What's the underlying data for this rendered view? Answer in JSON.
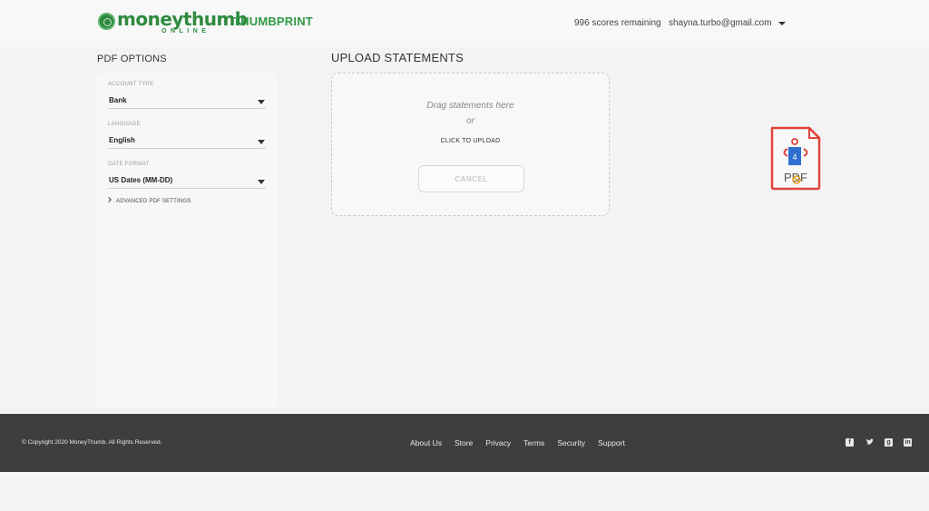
{
  "header": {
    "logo_word": "moneythumb",
    "logo_sub": "ONLINE",
    "separator": "·",
    "product": "THUMBPRINT",
    "scores": "996 scores remaining",
    "user_email": "shayna.turbo@gmail.com"
  },
  "pdf_options": {
    "title": "PDF OPTIONS",
    "account_type_label": "ACCOUNT TYPE",
    "account_type_value": "Bank",
    "language_label": "LANGUAGE",
    "language_value": "English",
    "date_format_label": "DATE FORMAT",
    "date_format_value": "US Dates (MM-DD)",
    "advanced_label": "ADVANCED PDF SETTINGS"
  },
  "upload": {
    "title": "UPLOAD STATEMENTS",
    "drag_text": "Drag statements here",
    "or_text": "or",
    "click_text": "CLICK TO UPLOAD",
    "cancel_label": "CANCEL"
  },
  "drag_icon": {
    "label": "PDF",
    "count": "4"
  },
  "footer": {
    "copyright": "© Copyright 2020 MoneyThumb. All Rights Reserved.",
    "links": [
      "About Us",
      "Store",
      "Privacy",
      "Terms",
      "Security",
      "Support"
    ],
    "social_icons": [
      "facebook-icon",
      "twitter-icon",
      "google-plus-icon",
      "linkedin-icon"
    ]
  },
  "colors": {
    "brand_green": "#2f8a3f",
    "footer_bg": "#3d3e3f",
    "pdf_red": "#e0443a",
    "pdf_blue": "#2f6fcf"
  }
}
